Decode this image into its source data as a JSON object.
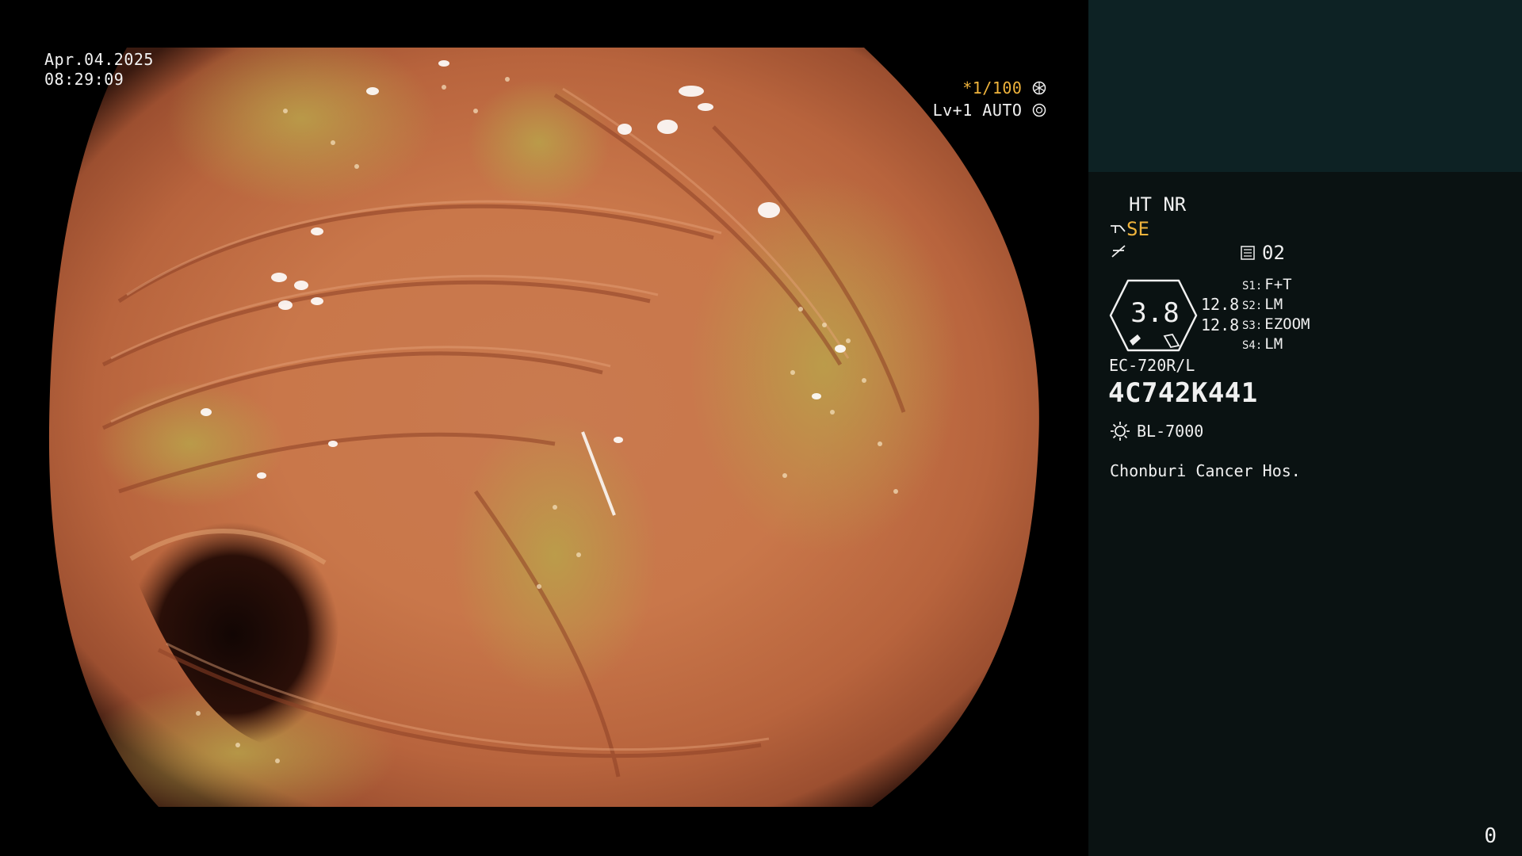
{
  "osd": {
    "date": "Apr.04.2025",
    "time": "08:29:09",
    "shutter": "*1/100",
    "level": "Lv+1 AUTO"
  },
  "panel": {
    "ht_nr": "HT NR",
    "se": "SE",
    "memo": "02",
    "badge_value": "3.8",
    "value_1": "12.8",
    "value_2": "12.8",
    "s_buttons": [
      {
        "key": "S1:",
        "value": "F+T"
      },
      {
        "key": "S2:",
        "value": "LM"
      },
      {
        "key": "S3:",
        "value": "EZOOM"
      },
      {
        "key": "S4:",
        "value": "LM"
      }
    ],
    "model": "EC-720R/L",
    "serial": "4C742K441",
    "light_source": "BL-7000",
    "hospital": "Chonburi Cancer Hos.",
    "counter": "0"
  },
  "colors": {
    "accent_orange": "#f0b43c",
    "panel_top": "#0d2224",
    "panel_bottom": "#0a1212"
  },
  "icons": [
    "aperture-icon",
    "iris-icon",
    "scope-tip-icon",
    "signal-icon",
    "memo-icon",
    "light-source-icon"
  ]
}
